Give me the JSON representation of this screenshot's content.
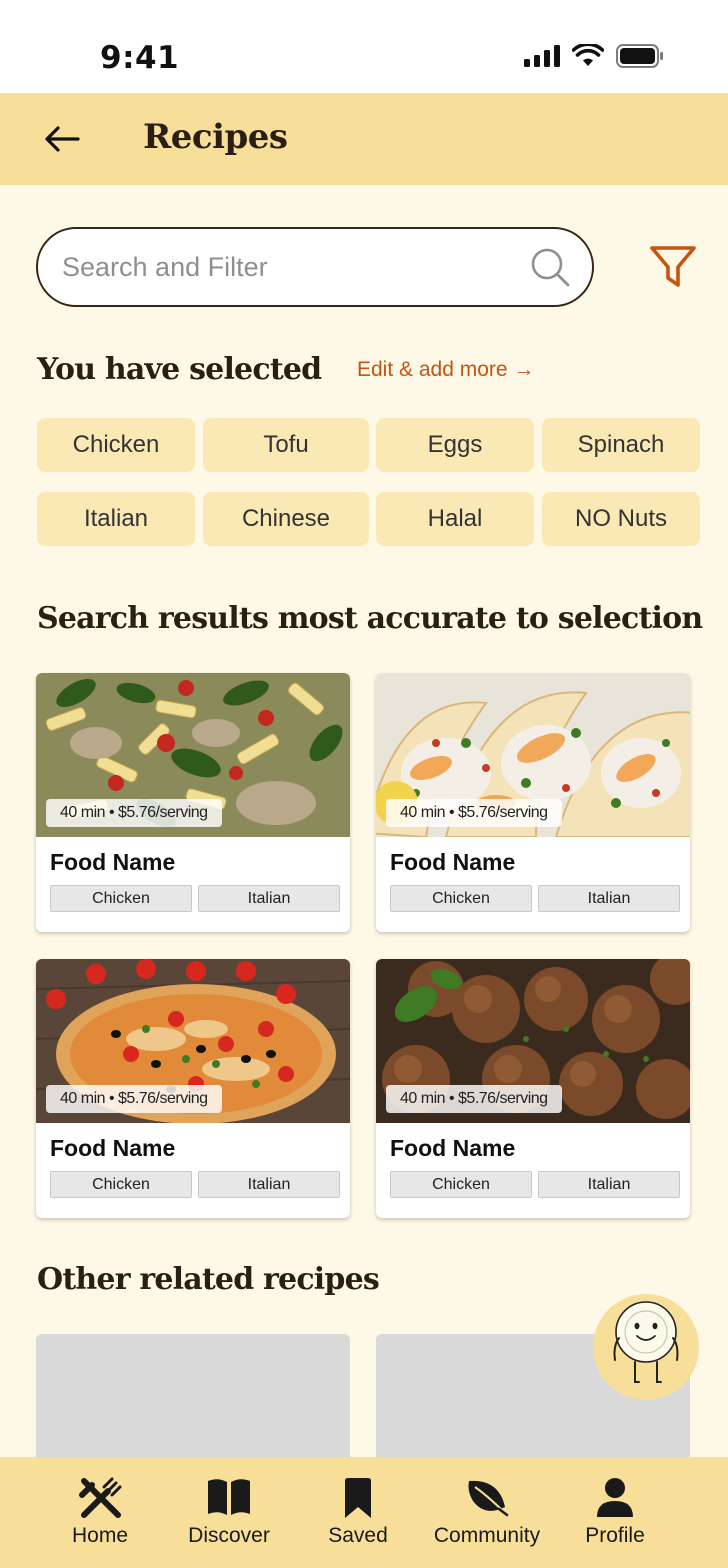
{
  "status_bar": {
    "time": "9:41"
  },
  "header": {
    "title": "Recipes"
  },
  "search": {
    "placeholder": "Search and Filter",
    "value": ""
  },
  "selection": {
    "heading": "You have selected",
    "edit_link": "Edit & add more →",
    "chips": [
      "Chicken",
      "Tofu",
      "Eggs",
      "Spinach",
      "Italian",
      "Chinese",
      "Halal",
      "NO Nuts"
    ]
  },
  "results": {
    "heading": "Search results most accurate to selection",
    "cards": [
      {
        "image": "pasta-photo",
        "meta": "40 min • $5.76/serving",
        "title": "Food Name",
        "tags": [
          "Chicken",
          "Italian"
        ]
      },
      {
        "image": "tacos-photo",
        "meta": "40 min • $5.76/serving",
        "title": "Food Name",
        "tags": [
          "Chicken",
          "Italian"
        ]
      },
      {
        "image": "pizza-photo",
        "meta": "40 min • $5.76/serving",
        "title": "Food Name",
        "tags": [
          "Chicken",
          "Italian"
        ]
      },
      {
        "image": "meatballs-photo",
        "meta": "40 min • $5.76/serving",
        "title": "Food Name",
        "tags": [
          "Chicken",
          "Italian"
        ]
      }
    ]
  },
  "related": {
    "heading": "Other related recipes"
  },
  "bottom_nav": {
    "items": [
      {
        "label": "Home",
        "icon": "utensils-icon"
      },
      {
        "label": "Discover",
        "icon": "book-icon"
      },
      {
        "label": "Saved",
        "icon": "bookmark-icon"
      },
      {
        "label": "Community",
        "icon": "leaf-icon"
      },
      {
        "label": "Profile",
        "icon": "person-icon"
      }
    ]
  },
  "colors": {
    "background": "#FEF9E7",
    "header": "#F7DF9A",
    "chip": "#FAE9B5",
    "accent": "#C55410",
    "text_dark": "#2a1f14"
  }
}
